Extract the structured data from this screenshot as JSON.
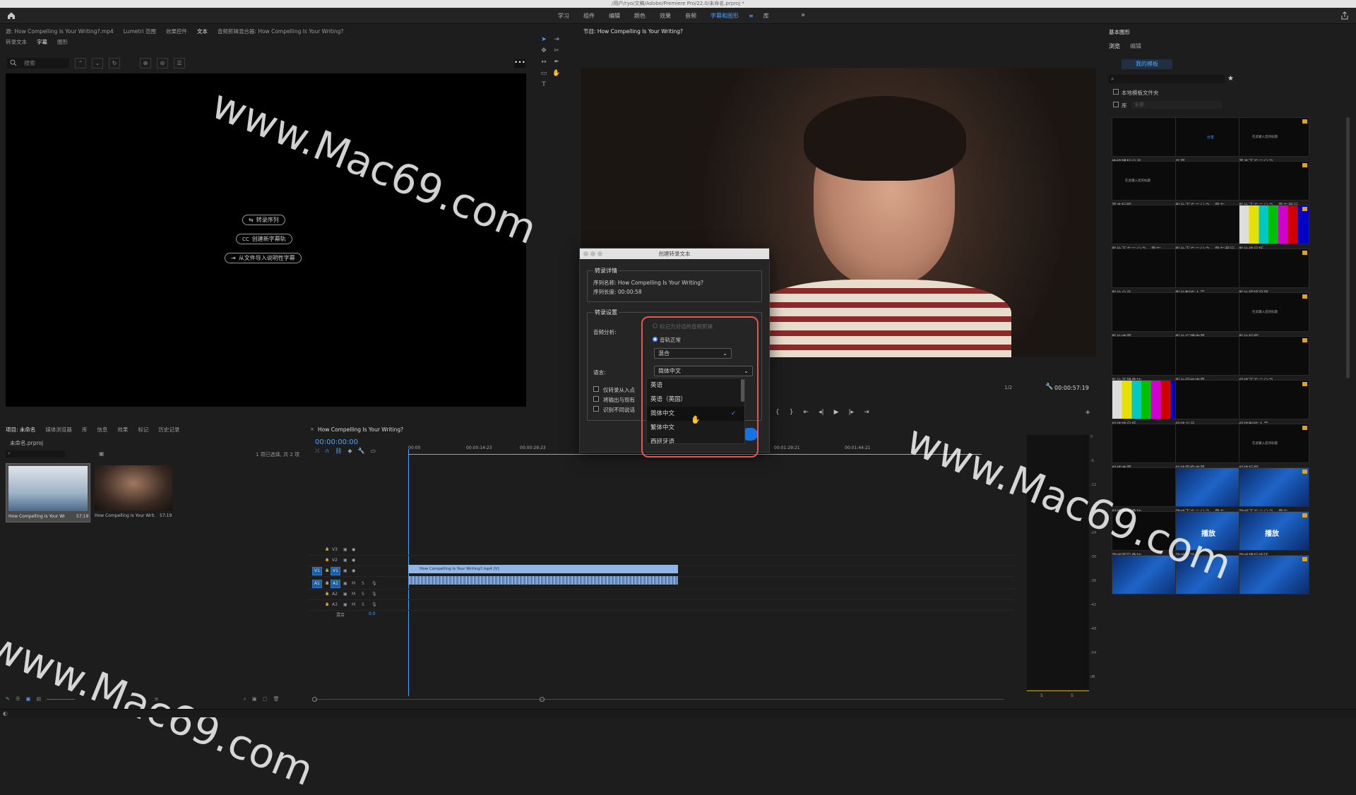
{
  "window_title": "/用户/ryo/文稿/Adobe/Premiere Pro/22.0/未命名.prproj *",
  "workspaces": {
    "items": [
      "学习",
      "组件",
      "编辑",
      "颜色",
      "效果",
      "音频",
      "字幕和图形",
      "库"
    ],
    "active": "字幕和图形",
    "more": "»"
  },
  "source_panel": {
    "tabs": [
      "源: How Compelling Is Your Writing?.mp4",
      "Lumetri 范围",
      "效果控件",
      "文本",
      "音频剪辑混合器: How Compelling Is Your Writing?"
    ],
    "active_tab": "文本",
    "subtabs": [
      "转录文本",
      "字幕",
      "图形"
    ],
    "active_subtab": "字幕",
    "search_placeholder": "搜索",
    "buttons": {
      "transcribe": "转录序列",
      "new_caption": "创建新字幕轨",
      "import_caption": "从文件导入说明性字幕"
    }
  },
  "program_monitor": {
    "title": "节目: How Compelling Is Your Writing?",
    "resolution": "1/2",
    "timecode": "00:00:57:19"
  },
  "essential_graphics": {
    "title": "基本图形",
    "tabs": [
      "浏览",
      "编辑"
    ],
    "active_tab": "浏览",
    "my_templates": "我的模板",
    "search_placeholder": "",
    "local_templates_folder": "本地模板文件夹",
    "library_label": "库",
    "library_select": "全部",
    "templates": [
      "传统播标出品",
      "共享",
      "基本下方三分之一",
      "基本标题",
      "影片下方三分之一靠右",
      "影片下方三分之一靠右两行",
      "影片下方三分之一靠左",
      "影片下方三分之一靠左两行",
      "影片信息板",
      "影片出品",
      "影片制作人员",
      "影片即将呈现",
      "影片字幕",
      "影片广播字幕",
      "影片标题",
      "影片直播叠加",
      "影片网格字幕",
      "斜体下方三分之一",
      "斜体信息板",
      "斜体出品",
      "斜体制作人员",
      "斜体字幕",
      "斜体图像字幕",
      "斜体标题",
      "斜体直播叠加",
      "游戏下方三分之一靠右",
      "游戏下方三分之一靠左",
      "游戏图形叠加",
      "游戏开场",
      "游戏播标循环",
      "",
      "",
      ""
    ],
    "template_inner_text": {
      "play": "播放",
      "share": "分享",
      "placeholder": "在此输入您的标题"
    }
  },
  "project_panel": {
    "tabs": [
      "项目: 未命名",
      "媒体浏览器",
      "库",
      "信息",
      "效果",
      "标记",
      "历史记录"
    ],
    "active_tab": "项目: 未命名",
    "file": "未命名.prproj",
    "selection": "1 项已选择, 共 2 项",
    "items": [
      {
        "name": "How Compelling Is Your Writ...",
        "duration": "57:19"
      },
      {
        "name": "How Compelling Is Your Writ...",
        "duration": "57:19"
      }
    ]
  },
  "timeline": {
    "title": "How Compelling Is Your Writing?",
    "timecode": "00:00:00:00",
    "ruler": [
      "00:00",
      "00:00:14:23",
      "00:00:29:23",
      "00:01:29:21",
      "00:01:44:21"
    ],
    "tracks": [
      "V3",
      "V2",
      "V1",
      "A1",
      "A2",
      "A3"
    ],
    "src_v": "V1",
    "src_a": "A1",
    "mix_label": "混合",
    "mix_value": "0.0",
    "clip_video": "How Compelling Is Your Writing?.mp4 [V]",
    "track_buttons": {
      "m": "M",
      "s": "S"
    }
  },
  "dialog": {
    "title": "创建转录文本",
    "details_legend": "转录详情",
    "sequence_name": "序列名称: How Compelling Is Your Writing?",
    "sequence_length": "序列长度: 00:00:58",
    "settings_legend": "转录设置",
    "audio_analysis_label": "音频分析:",
    "radio_option1": "标记为对话的音频剪辑",
    "radio_option2": "音轨正常",
    "mix_select": "混合",
    "language_label": "语言:",
    "language_select": "简体中文",
    "checkbox1": "仅转录从入点",
    "checkbox2": "将输出与现有",
    "checkbox3": "识别不同说话",
    "language_options": [
      "英语",
      "英语（英国）",
      "简体中文",
      "繁体中文",
      "西班牙语"
    ],
    "selected_language": "简体中文"
  },
  "meters": {
    "labels": [
      "S",
      "S"
    ],
    "scale": [
      "0",
      "-6",
      "-12",
      "-18",
      "-24",
      "-30",
      "-36",
      "-42",
      "-48",
      "-54",
      "dB"
    ]
  },
  "watermark": "www.Mac69.com"
}
